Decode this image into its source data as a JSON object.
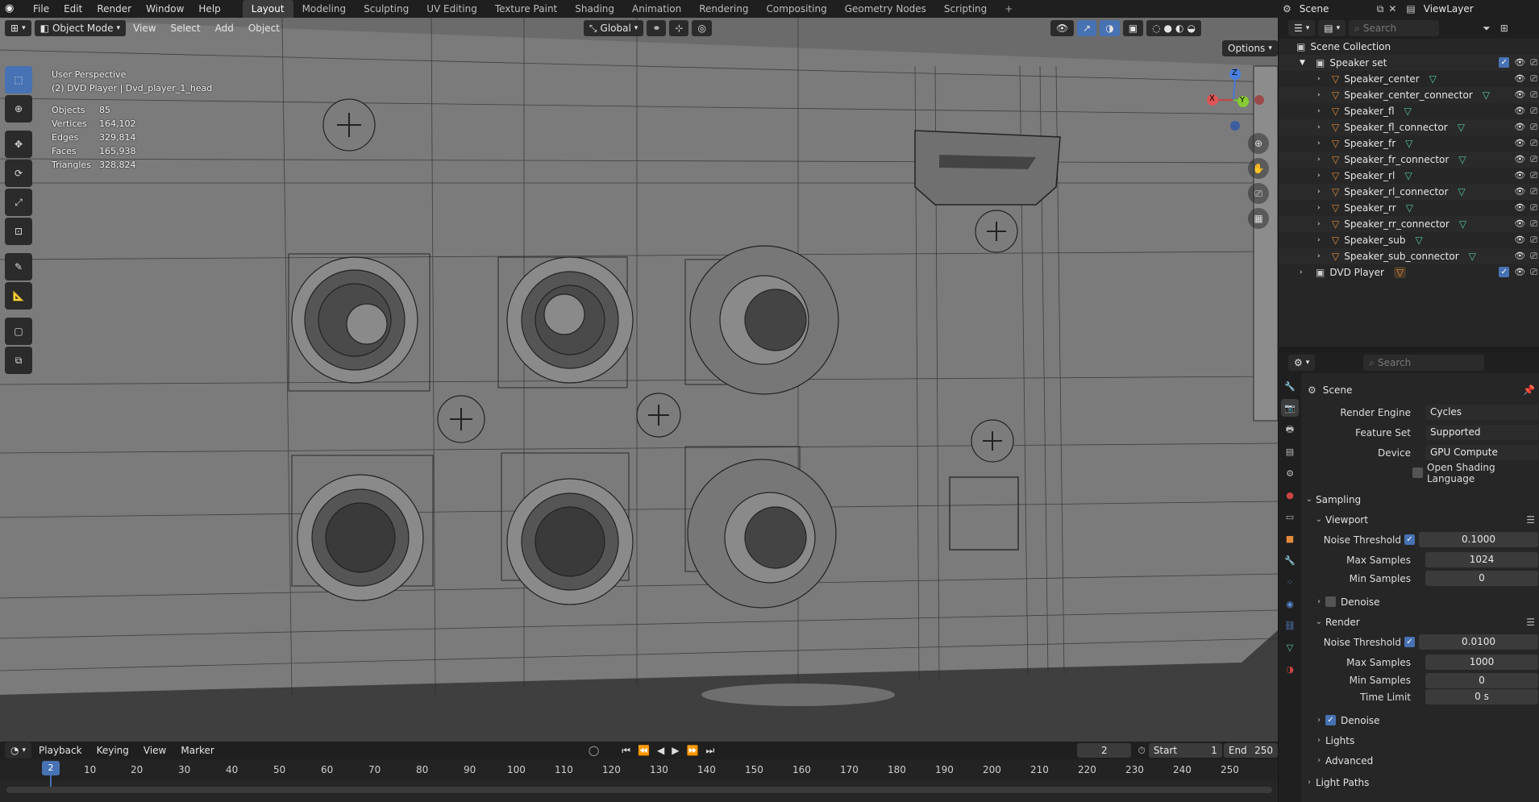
{
  "app": {
    "menus": [
      "File",
      "Edit",
      "Render",
      "Window",
      "Help"
    ],
    "workspaces": [
      "Layout",
      "Modeling",
      "Sculpting",
      "UV Editing",
      "Texture Paint",
      "Shading",
      "Animation",
      "Rendering",
      "Compositing",
      "Geometry Nodes",
      "Scripting"
    ],
    "active_workspace": "Layout",
    "plus": "+",
    "scene": "Scene",
    "view_layer": "ViewLayer"
  },
  "viewport": {
    "mode": "Object Mode",
    "menus": [
      "View",
      "Select",
      "Add",
      "Object"
    ],
    "transform_orientation": "Global",
    "options": "Options",
    "perspective": "User Perspective",
    "active_object": "(2) DVD Player | Dvd_player_1_head",
    "stats": [
      {
        "k": "Objects",
        "v": "85"
      },
      {
        "k": "Vertices",
        "v": "164,102"
      },
      {
        "k": "Edges",
        "v": "329,814"
      },
      {
        "k": "Faces",
        "v": "165,938"
      },
      {
        "k": "Triangles",
        "v": "328,824"
      }
    ],
    "gizmo": {
      "x": "X",
      "y": "Y",
      "z": "Z"
    }
  },
  "timeline": {
    "menus": [
      "Playback",
      "Keying",
      "View",
      "Marker"
    ],
    "current_frame": "2",
    "start_label": "Start",
    "start": "1",
    "end_label": "End",
    "end": "250",
    "ticks": [
      "10",
      "20",
      "30",
      "40",
      "50",
      "60",
      "70",
      "80",
      "90",
      "100",
      "110",
      "120",
      "130",
      "140",
      "150",
      "160",
      "170",
      "180",
      "190",
      "200",
      "210",
      "220",
      "230",
      "240",
      "250"
    ]
  },
  "outliner": {
    "search_placeholder": "Search",
    "root": "Scene Collection",
    "items": [
      {
        "name": "Speaker set",
        "level": 1,
        "type": "collection"
      },
      {
        "name": "Speaker_center",
        "level": 2
      },
      {
        "name": "Speaker_center_connector",
        "level": 2
      },
      {
        "name": "Speaker_fl",
        "level": 2
      },
      {
        "name": "Speaker_fl_connector",
        "level": 2
      },
      {
        "name": "Speaker_fr",
        "level": 2
      },
      {
        "name": "Speaker_fr_connector",
        "level": 2
      },
      {
        "name": "Speaker_rl",
        "level": 2
      },
      {
        "name": "Speaker_rl_connector",
        "level": 2
      },
      {
        "name": "Speaker_rr",
        "level": 2
      },
      {
        "name": "Speaker_rr_connector",
        "level": 2
      },
      {
        "name": "Speaker_sub",
        "level": 2
      },
      {
        "name": "Speaker_sub_connector",
        "level": 2
      },
      {
        "name": "DVD Player",
        "level": 1,
        "type": "collection"
      }
    ]
  },
  "properties": {
    "search_placeholder": "Search",
    "context": "Scene",
    "render_engine_label": "Render Engine",
    "render_engine": "Cycles",
    "feature_set_label": "Feature Set",
    "feature_set": "Supported",
    "device_label": "Device",
    "device": "GPU Compute",
    "osl": "Open Shading Language",
    "sampling": "Sampling",
    "viewport": "Viewport",
    "render": "Render",
    "noise_threshold_label": "Noise Threshold",
    "vp_noise_threshold": "0.1000",
    "max_samples_label": "Max Samples",
    "vp_max_samples": "1024",
    "min_samples_label": "Min Samples",
    "vp_min_samples": "0",
    "denoise": "Denoise",
    "r_noise_threshold": "0.0100",
    "r_max_samples": "1000",
    "r_min_samples": "0",
    "time_limit_label": "Time Limit",
    "time_limit": "0 s",
    "lights": "Lights",
    "advanced": "Advanced",
    "light_paths": "Light Paths"
  }
}
